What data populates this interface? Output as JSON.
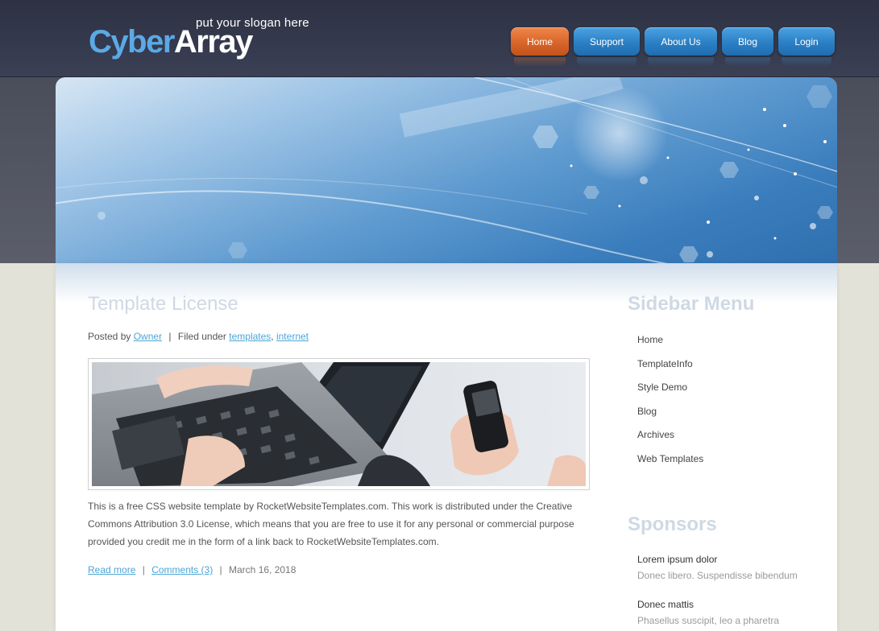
{
  "brand": {
    "logo_part1": "Cyber",
    "logo_part2": "Array",
    "slogan": "put your slogan here"
  },
  "nav": {
    "items": [
      {
        "label": "Home",
        "active": true
      },
      {
        "label": "Support",
        "active": false
      },
      {
        "label": "About Us",
        "active": false
      },
      {
        "label": "Blog",
        "active": false
      },
      {
        "label": "Login",
        "active": false
      }
    ]
  },
  "post": {
    "title": "Template License",
    "meta": {
      "posted_by_prefix": "Posted by",
      "author": "Owner",
      "filed_under_prefix": "Filed under",
      "tags": [
        "templates",
        "internet"
      ]
    },
    "body": "This is a free CSS website template by RocketWebsiteTemplates.com. This work is distributed under the Creative Commons Attribution 3.0 License, which means that you are free to use it for any personal or commercial purpose provided you credit me in the form of a link back to RocketWebsiteTemplates.com.",
    "footer": {
      "read_more": "Read more",
      "comments": "Comments (3)",
      "date": "March 16, 2018"
    }
  },
  "sidebar": {
    "menu_title": "Sidebar Menu",
    "menu_items": [
      "Home",
      "TemplateInfo",
      "Style Demo",
      "Blog",
      "Archives",
      "Web Templates"
    ],
    "sponsors_title": "Sponsors",
    "sponsors": [
      {
        "name": "Lorem ipsum dolor",
        "desc": "Donec libero. Suspendisse bibendum"
      },
      {
        "name": "Donec mattis",
        "desc": "Phasellus suscipit, leo a pharetra"
      }
    ]
  },
  "colors": {
    "accent_blue": "#4ba6d6",
    "nav_active": "#d8652a",
    "nav_default": "#2b7fc4",
    "header_bg": "#2d3143"
  }
}
